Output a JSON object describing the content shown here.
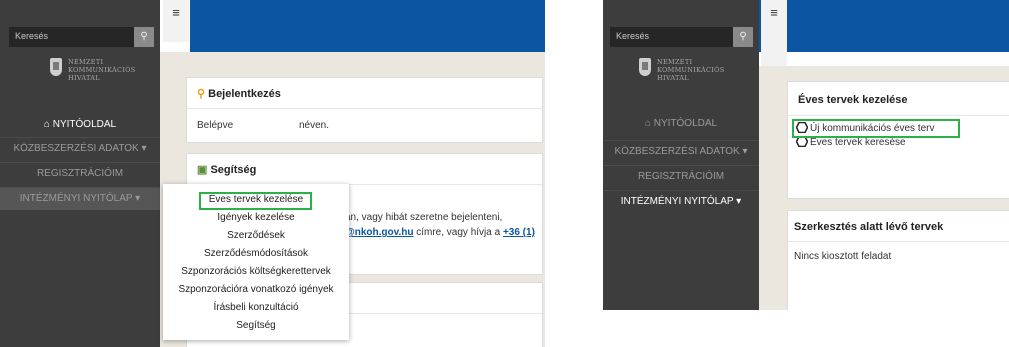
{
  "sidebar": {
    "search_placeholder": "Keresés",
    "search_icon": "magnifier",
    "logo_lines": [
      "NEMZETI",
      "KOMMUNIKÁCIÓS",
      "HIVATAL"
    ],
    "nav": [
      "NYITÓOLDAL",
      "KÖZBESZERZÉSI ADATOK ▾",
      "REGISZTRÁCIÓIM",
      "INTÉZMÉNYI NYITÓLAP ▾"
    ]
  },
  "left": {
    "login_title": "Bejelentkezés",
    "login_text_a": "Belépve",
    "login_text_b": "néven.",
    "help_title": "Segítség",
    "help_line1": "an, vagy hibát szeretne bejelenteni,",
    "help_email": "@nkoh.gov.hu",
    "help_mid": " címre, vagy hívja a ",
    "help_phone": "+36 (1)",
    "dropdown": [
      "Éves tervek kezelése",
      "Igények kezelése",
      "Szerződések",
      "Szerződésmódosítások",
      "Szponzorációs költségkerettervek",
      "Szponzorációra vonatkozó igények",
      "Írásbeli konzultáció",
      "Segítség"
    ]
  },
  "right": {
    "plans_title": "Éves tervek kezelése",
    "new_plan": "Új kommunikációs éves terv",
    "search_plans": "Éves tervek keresése",
    "drafts_title": "Szerkesztés alatt lévő tervek",
    "no_task": "Nincs kiosztott feladat"
  },
  "colors": {
    "topbar": "#0b55a3",
    "sidebar": "#3d3d3d",
    "highlight": "#2bb04a"
  }
}
